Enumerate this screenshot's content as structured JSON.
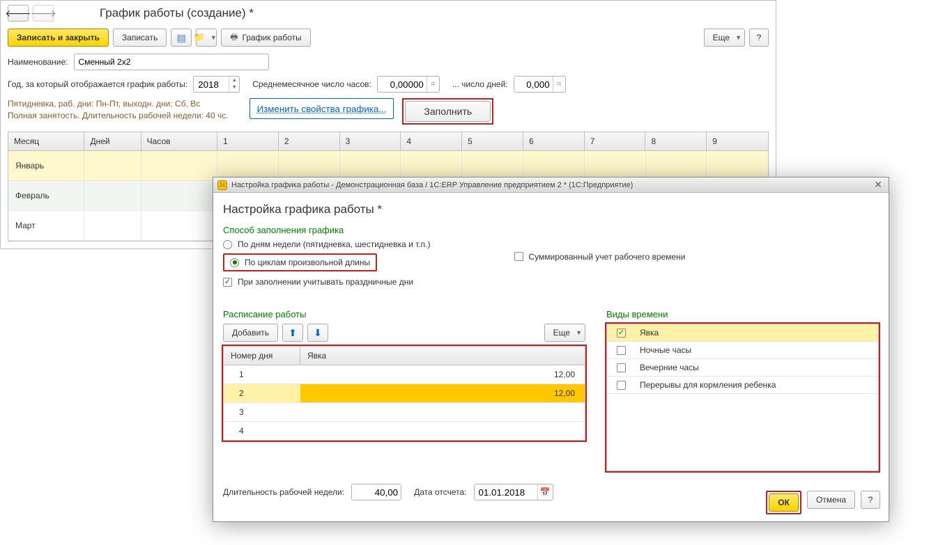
{
  "main": {
    "title": "График работы (создание) *",
    "toolbar": {
      "write_close": "Записать и закрыть",
      "write": "Записать",
      "print_schedule": "График работы",
      "more": "Еще",
      "help": "?"
    },
    "name_label": "Наименование:",
    "name_value": "Сменный 2х2",
    "year_label": "Год, за который отображается график работы:",
    "year_value": "2018",
    "avg_hours_label": "Среднемесячное число часов:",
    "avg_hours_value": "0,00000",
    "avg_days_label": "... число дней:",
    "avg_days_value": "0,000",
    "note_line1": "Пятидневка, раб. дни: Пн-Пт, выходн. дни: Сб, Вс",
    "note_line2": "Полная занятость. Длительность рабочей недели: 40 чс.",
    "change_props": "Изменить свойства графика...",
    "fill": "Заполнить",
    "table": {
      "headers": {
        "month": "Месяц",
        "days": "Дней",
        "hours": "Часов"
      },
      "day_cols": [
        "1",
        "2",
        "3",
        "4",
        "5",
        "6",
        "7",
        "8",
        "9"
      ],
      "rows": {
        "jan": "Январь",
        "feb": "Февраль",
        "mar": "Март"
      }
    }
  },
  "dialog": {
    "chrome_title": "Настройка графика работы - Демонстрационная база / 1С:ERP Управление предприятием 2 *  (1С:Предприятие)",
    "title": "Настройка графика работы *",
    "method_label": "Способ заполнения графика",
    "summarized_label": "Суммированный учет рабочего времени",
    "radio1": "По дням недели (пятидневка, шестидневка и т.п.)",
    "radio2": "По циклам произвольной длины",
    "check_holidays": "При заполнении учитывать праздничные дни",
    "schedule_label": "Расписание работы",
    "types_label": "Виды времени",
    "add": "Добавить",
    "more": "Еще",
    "sched_headers": {
      "num": "Номер дня",
      "att": "Явка"
    },
    "sched_rows": [
      {
        "num": "1",
        "att": "12,00"
      },
      {
        "num": "2",
        "att": "12,00"
      },
      {
        "num": "3",
        "att": ""
      },
      {
        "num": "4",
        "att": ""
      }
    ],
    "types": [
      {
        "label": "Явка",
        "checked": true
      },
      {
        "label": "Ночные часы",
        "checked": false
      },
      {
        "label": "Вечерние часы",
        "checked": false
      },
      {
        "label": "Перерывы для кормления ребенка",
        "checked": false
      }
    ],
    "week_len_label": "Длительность рабочей недели:",
    "week_len_value": "40,00",
    "start_date_label": "Дата отсчета:",
    "start_date_value": "01.01.2018",
    "ok": "ОК",
    "cancel": "Отмена",
    "help": "?"
  }
}
